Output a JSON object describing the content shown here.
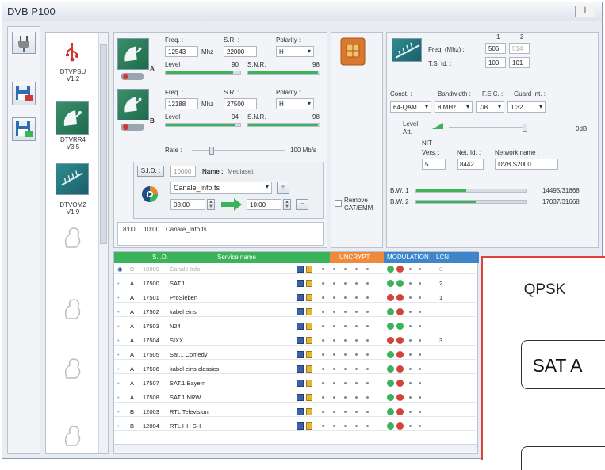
{
  "window": {
    "title": "DVB P100",
    "close_label": "ꟾ"
  },
  "devices": [
    {
      "label": "DTVPSU\nV1.2"
    },
    {
      "label": "DTVRR4\nV3.5"
    },
    {
      "label": "DTVOM2\nV1.9"
    }
  ],
  "tuner_a": {
    "freq_label": "Freq. :",
    "freq": "12543",
    "freq_unit": "Mhz",
    "sr_label": "S.R. :",
    "sr": "22000",
    "polarity_label": "Polarity :",
    "polarity": "H",
    "level_label": "Level",
    "level": "90",
    "level_pct": 0.9,
    "snr_label": "S.N.R.",
    "snr": "98",
    "snr_pct": 0.98,
    "tag": "A"
  },
  "tuner_b": {
    "freq_label": "Freq. :",
    "freq": "12188",
    "freq_unit": "Mhz",
    "sr_label": "S.R. :",
    "sr": "27500",
    "polarity_label": "Polarity :",
    "polarity": "H",
    "level_label": "Level",
    "level": "94",
    "level_pct": 0.94,
    "snr_label": "S.N.R.",
    "snr": "98",
    "snr_pct": 0.98,
    "tag": "B"
  },
  "rate": {
    "label": "Rate :",
    "value": "100 Mb/s"
  },
  "sid": {
    "label": "S.I.D. :",
    "value": "10000",
    "name_label": "Name :",
    "name": "Mediaset"
  },
  "playlist": {
    "file": "Canale_Info.ts",
    "plus": "+",
    "minus": "−",
    "start": "08:00",
    "end": "10:00",
    "schedule_row": {
      "start": "8:00",
      "end": "10:00",
      "file": "Canale_Info.ts"
    }
  },
  "remove": {
    "label": "Remove\nCAT/EMM"
  },
  "dvbt": {
    "col1": "1",
    "col2": "2",
    "freq_label": "Freq. (Mhz) :",
    "freq1": "506",
    "freq2": "514",
    "ts_label": "T.S. Id. :",
    "ts1": "100",
    "ts2": "101",
    "const_label": "Const. :",
    "const": "64-QAM",
    "bw_label": "Bandwidth :",
    "bw": "8 MHz",
    "fec_label": "F.E.C. :",
    "fec": "7/8",
    "guard_label": "Guard Int. :",
    "guard": "1/32",
    "level_att_label": "Level\nAtt.",
    "level_att_value": "0dB",
    "nit_label": "NIT",
    "vers_label": "Vers. :",
    "vers": "5",
    "netid_label": "Net. Id. :",
    "netid": "8442",
    "netname_label": "Network name :",
    "netname": "DVB S2000",
    "bw1_label": "B.W. 1",
    "bw1_value": "14495/31668",
    "bw1_pct": 0.46,
    "bw2_label": "B.W. 2",
    "bw2_value": "17037/31668",
    "bw2_pct": 0.54
  },
  "table": {
    "headers": {
      "sid": "S.I.D.",
      "service": "Service name",
      "uncrypt": "UNCRYPT",
      "modulation": "MODULATION",
      "lcn": "LCN"
    },
    "rows": [
      {
        "src": "D",
        "sid": "10000",
        "name": "Canale Info",
        "lcn": "0",
        "dim": true
      },
      {
        "src": "A",
        "sid": "17500",
        "name": "SAT.1",
        "lcn": "2"
      },
      {
        "src": "A",
        "sid": "17501",
        "name": "ProSieben",
        "lcn": "1"
      },
      {
        "src": "A",
        "sid": "17502",
        "name": "kabel eins",
        "lcn": ""
      },
      {
        "src": "A",
        "sid": "17503",
        "name": "N24",
        "lcn": ""
      },
      {
        "src": "A",
        "sid": "17504",
        "name": "SIXX",
        "lcn": "3"
      },
      {
        "src": "A",
        "sid": "17505",
        "name": "Sat.1 Comedy",
        "lcn": ""
      },
      {
        "src": "A",
        "sid": "17506",
        "name": "kabel eins classics",
        "lcn": ""
      },
      {
        "src": "A",
        "sid": "17507",
        "name": "SAT.1 Bayern",
        "lcn": ""
      },
      {
        "src": "A",
        "sid": "17508",
        "name": "SAT.1 NRW",
        "lcn": ""
      },
      {
        "src": "B",
        "sid": "12003",
        "name": "RTL Television",
        "lcn": ""
      },
      {
        "src": "B",
        "sid": "12004",
        "name": "RTL HH SH",
        "lcn": ""
      }
    ]
  },
  "overlay": {
    "title": "QPSK",
    "box": "SAT A"
  },
  "colors": {
    "green": "#3bb35a",
    "orange": "#f08a3a",
    "blue": "#3e86c9",
    "red": "#e0403a"
  }
}
